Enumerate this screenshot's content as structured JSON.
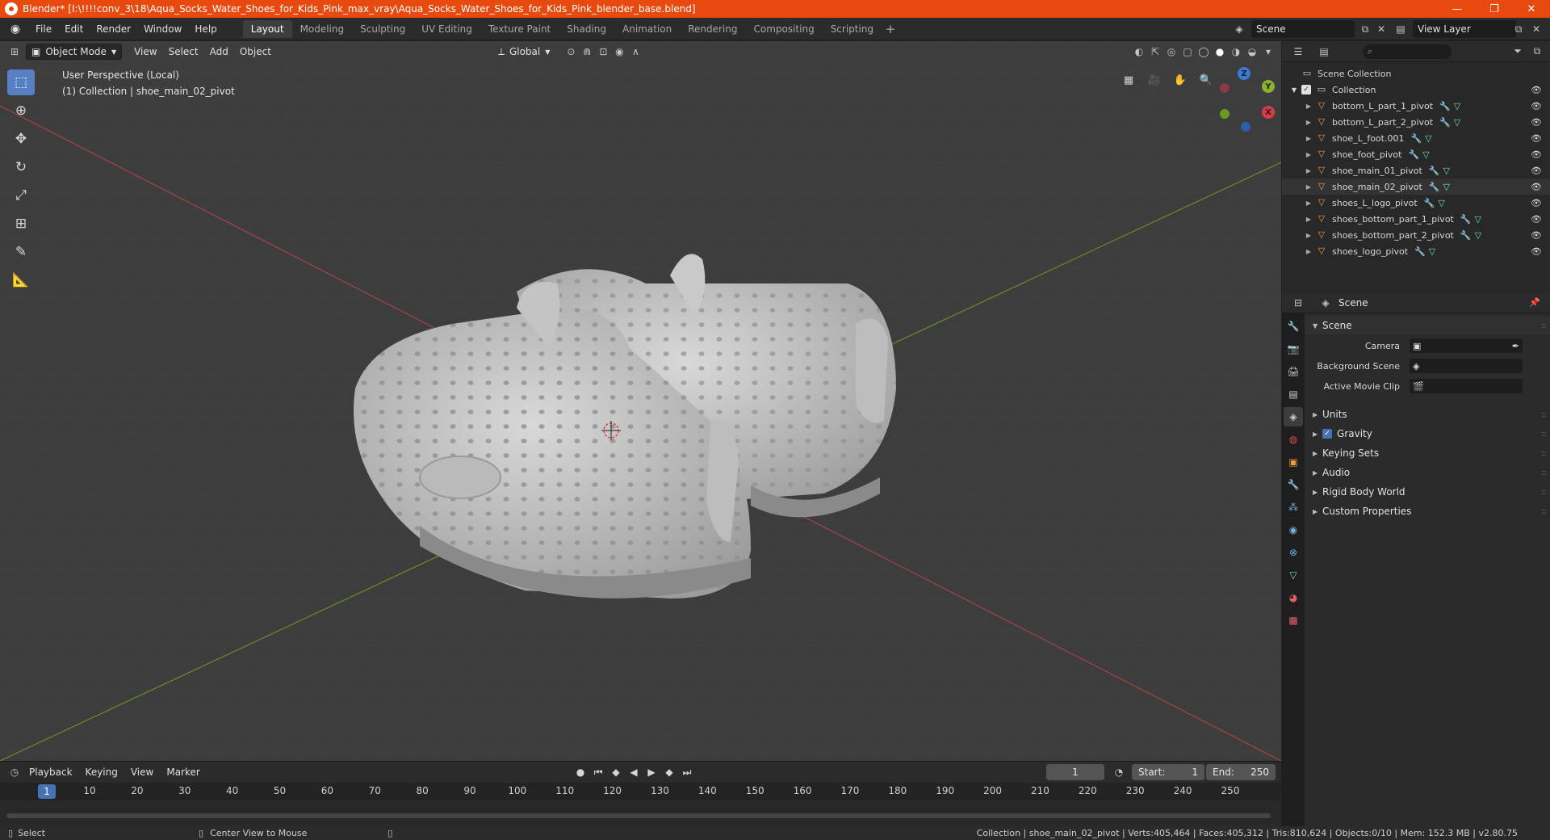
{
  "window": {
    "title": "Blender* [I:\\!!!!conv_3\\18\\Aqua_Socks_Water_Shoes_for_Kids_Pink_max_vray\\Aqua_Socks_Water_Shoes_for_Kids_Pink_blender_base.blend]",
    "minimize": "—",
    "maximize": "❐",
    "close": "✕"
  },
  "menu": [
    "File",
    "Edit",
    "Render",
    "Window",
    "Help"
  ],
  "workspaces": [
    "Layout",
    "Modeling",
    "Sculpting",
    "UV Editing",
    "Texture Paint",
    "Shading",
    "Animation",
    "Rendering",
    "Compositing",
    "Scripting"
  ],
  "active_workspace": "Layout",
  "scene_name": "Scene",
  "view_layer": "View Layer",
  "viewport": {
    "mode": "Object Mode",
    "menus": [
      "View",
      "Select",
      "Add",
      "Object"
    ],
    "transform_orientation": "Global",
    "info_line1": "User Perspective (Local)",
    "info_line2": "(1) Collection | shoe_main_02_pivot"
  },
  "gizmo": {
    "x": "X",
    "y": "Y",
    "z": "Z"
  },
  "timeline": {
    "menus": [
      "Playback",
      "Keying",
      "View",
      "Marker"
    ],
    "current_frame": "1",
    "start_label": "Start:",
    "start": "1",
    "end_label": "End:",
    "end": "250",
    "ruler": [
      "1",
      "10",
      "20",
      "30",
      "40",
      "50",
      "60",
      "70",
      "80",
      "90",
      "100",
      "110",
      "120",
      "130",
      "140",
      "150",
      "160",
      "170",
      "180",
      "190",
      "200",
      "210",
      "220",
      "230",
      "240",
      "250"
    ]
  },
  "status": {
    "select": "Select",
    "center_view": "Center View to Mouse",
    "stats": "Collection | shoe_main_02_pivot | Verts:405,464 | Faces:405,312 | Tris:810,624 | Objects:0/10 | Mem: 152.3 MB | v2.80.75"
  },
  "outliner": {
    "scene_collection": "Scene Collection",
    "collection": "Collection",
    "objects": [
      "bottom_L_part_1_pivot",
      "bottom_L_part_2_pivot",
      "shoe_L_foot.001",
      "shoe_foot_pivot",
      "shoe_main_01_pivot",
      "shoe_main_02_pivot",
      "shoes_L_logo_pivot",
      "shoes_bottom_part_1_pivot",
      "shoes_bottom_part_2_pivot",
      "shoes_logo_pivot"
    ]
  },
  "properties": {
    "header": "Scene",
    "panel_title": "Scene",
    "camera_label": "Camera",
    "background_scene_label": "Background Scene",
    "active_movie_clip_label": "Active Movie Clip",
    "panels": [
      "Units",
      "Gravity",
      "Keying Sets",
      "Audio",
      "Rigid Body World",
      "Custom Properties"
    ]
  }
}
